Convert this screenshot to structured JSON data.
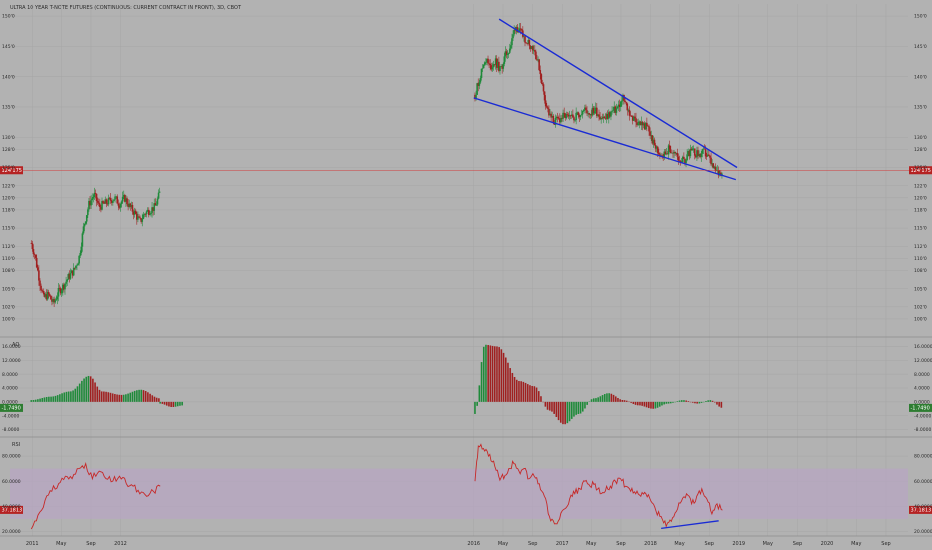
{
  "header": {
    "symbol_line": "ULTRA 10 YEAR T-NOTE FUTURES (CONTINUOUS: CURRENT CONTRACT IN FRONT), 3D, CBOT"
  },
  "colors": {
    "background": "#b2b2b2",
    "up": "#1f8a3a",
    "down": "#a02020",
    "trendline": "#1a2bd4",
    "rsi_line": "#c62828",
    "rsi_band": "#b7a6c2",
    "price_line": "#d13a3a",
    "badge_red": "#b52222",
    "badge_green": "#2e7d32"
  },
  "chart_data": [
    {
      "type": "candlestick",
      "pane": "price",
      "price_ticks": [
        "150'0",
        "145'0",
        "140'0",
        "135'0",
        "130'0",
        "128'0",
        "125'0",
        "122'0",
        "120'0",
        "118'0",
        "115'0",
        "112'0",
        "110'0",
        "108'0",
        "105'0",
        "102'0",
        "100'0"
      ],
      "current_price_label": "124'175",
      "current_price": 124.55,
      "series": [
        {
          "x": [
            "2010-12-28",
            "2011-01-12",
            "2011-02-02",
            "2011-02-16",
            "2011-03-09",
            "2011-03-30",
            "2011-04-20",
            "2011-05-11",
            "2011-06-01",
            "2011-06-22",
            "2011-07-13",
            "2011-08-03",
            "2011-08-24",
            "2011-09-14",
            "2011-10-05",
            "2011-10-26",
            "2011-11-16",
            "2011-12-07",
            "2011-12-28",
            "2012-01-18",
            "2012-02-08",
            "2012-02-29",
            "2012-03-21",
            "2012-04-11",
            "2012-05-02",
            "2012-05-23",
            "2012-06-13"
          ],
          "close": [
            112.5,
            110.5,
            106.0,
            103.5,
            104.0,
            102.5,
            104.5,
            105.5,
            107.0,
            108.0,
            110.0,
            115.5,
            119.0,
            120.5,
            118.5,
            119.0,
            119.5,
            120.0,
            119.0,
            120.0,
            118.5,
            117.5,
            116.0,
            117.5,
            118.0,
            118.5,
            121.0
          ]
        },
        {
          "x": [
            "2016-01-06",
            "2016-01-27",
            "2016-02-17",
            "2016-03-09",
            "2016-03-30",
            "2016-04-20",
            "2016-05-11",
            "2016-06-01",
            "2016-06-22",
            "2016-07-06",
            "2016-07-27",
            "2016-08-17",
            "2016-09-07",
            "2016-09-28",
            "2016-10-19",
            "2016-11-09",
            "2016-11-30",
            "2016-12-21",
            "2017-01-11",
            "2017-02-01",
            "2017-02-22",
            "2017-03-15",
            "2017-04-05",
            "2017-04-26",
            "2017-05-17",
            "2017-06-07",
            "2017-06-28",
            "2017-07-19",
            "2017-08-09",
            "2017-08-30",
            "2017-09-08",
            "2017-09-29",
            "2017-10-20",
            "2017-11-10",
            "2017-12-01",
            "2017-12-22",
            "2018-01-12",
            "2018-02-02",
            "2018-02-23",
            "2018-03-16",
            "2018-04-06",
            "2018-04-27",
            "2018-05-18",
            "2018-06-08",
            "2018-06-29",
            "2018-07-20",
            "2018-08-10",
            "2018-08-31",
            "2018-09-21",
            "2018-10-12",
            "2018-10-26"
          ],
          "close": [
            137.0,
            140.0,
            143.0,
            141.5,
            142.5,
            141.0,
            143.5,
            145.0,
            148.5,
            147.5,
            146.5,
            145.5,
            144.5,
            141.5,
            136.5,
            133.5,
            132.5,
            133.0,
            133.5,
            133.0,
            133.5,
            134.0,
            134.5,
            134.0,
            134.5,
            133.5,
            133.0,
            134.0,
            134.5,
            135.5,
            136.5,
            134.5,
            133.0,
            132.5,
            132.0,
            131.5,
            129.0,
            127.5,
            127.0,
            128.0,
            127.5,
            126.5,
            126.0,
            127.5,
            127.5,
            127.0,
            127.5,
            126.5,
            124.5,
            124.0,
            124.5
          ]
        }
      ],
      "trendlines": [
        {
          "name": "upper",
          "from": {
            "x": "2016-04-15",
            "y": 149.5
          },
          "to": {
            "x": "2018-12-25",
            "y": 125.0
          }
        },
        {
          "name": "lower",
          "from": {
            "x": "2016-01-01",
            "y": 136.5
          },
          "to": {
            "x": "2018-12-20",
            "y": 123.0
          }
        }
      ]
    },
    {
      "type": "bar",
      "pane": "AO",
      "label": "AO",
      "ticks": [
        "16.0000",
        "12.0000",
        "8.0000",
        "4.0000",
        "0.0000",
        "-4.0000",
        "-8.0000"
      ],
      "ylim": [
        -9.0,
        17.0
      ],
      "current_value_label": "-1.7490",
      "segments": [
        {
          "x_start": "2010-12-28",
          "x_end": "2012-06-13",
          "peaks": [
            [
              0.0,
              0.5
            ],
            [
              0.15,
              1.5
            ],
            [
              0.3,
              3.0
            ],
            [
              0.45,
              7.5
            ],
            [
              0.55,
              3.0
            ],
            [
              0.7,
              2.0
            ],
            [
              0.85,
              3.5
            ],
            [
              1.0,
              1.0
            ]
          ]
        },
        {
          "x_start": "2012-06-13",
          "x_end": "2012-09-20",
          "peaks": [
            [
              0.0,
              -0.5
            ],
            [
              0.5,
              -1.5
            ],
            [
              1.0,
              -1.0
            ]
          ]
        },
        {
          "x_start": "2016-01-06",
          "x_end": "2018-10-26",
          "peaks": [
            [
              0.0,
              -3.5
            ],
            [
              0.04,
              16.5
            ],
            [
              0.09,
              16.0
            ],
            [
              0.18,
              6.0
            ],
            [
              0.24,
              4.5
            ],
            [
              0.3,
              -2.5
            ],
            [
              0.36,
              -6.5
            ],
            [
              0.42,
              -3.5
            ],
            [
              0.48,
              1.0
            ],
            [
              0.54,
              2.5
            ],
            [
              0.6,
              0.5
            ],
            [
              0.66,
              -1.0
            ],
            [
              0.72,
              -2.0
            ],
            [
              0.78,
              -0.5
            ],
            [
              0.84,
              0.5
            ],
            [
              0.9,
              -0.5
            ],
            [
              0.95,
              0.5
            ],
            [
              1.0,
              -1.75
            ]
          ]
        }
      ]
    },
    {
      "type": "line",
      "pane": "RSI",
      "label": "RSI",
      "ticks": [
        "80.0000",
        "60.0000",
        "40.0000",
        "20.0000"
      ],
      "ylim": [
        18.0,
        92.0
      ],
      "band": [
        30,
        70
      ],
      "current_value_label": "37.1813",
      "segments": [
        {
          "x": [
            "2010-12-28",
            "2011-01-25",
            "2011-02-23",
            "2011-03-23",
            "2011-04-20",
            "2011-05-18",
            "2011-06-15",
            "2011-07-13",
            "2011-08-10",
            "2011-09-07",
            "2011-10-05",
            "2011-11-02",
            "2011-11-30",
            "2011-12-28",
            "2012-01-25",
            "2012-02-22",
            "2012-03-21",
            "2012-04-18",
            "2012-05-16",
            "2012-06-13"
          ],
          "y": [
            22,
            33,
            45,
            52,
            58,
            64,
            62,
            70,
            74,
            62,
            68,
            62,
            60,
            64,
            58,
            56,
            50,
            48,
            52,
            56
          ]
        },
        {
          "x": [
            "2016-01-06",
            "2016-01-20",
            "2016-02-10",
            "2016-03-02",
            "2016-03-23",
            "2016-04-13",
            "2016-05-04",
            "2016-05-25",
            "2016-06-15",
            "2016-07-06",
            "2016-07-27",
            "2016-08-17",
            "2016-09-07",
            "2016-09-28",
            "2016-10-19",
            "2016-11-09",
            "2016-11-30",
            "2016-12-21",
            "2017-01-11",
            "2017-02-01",
            "2017-02-22",
            "2017-03-15",
            "2017-04-05",
            "2017-04-26",
            "2017-05-17",
            "2017-06-07",
            "2017-06-28",
            "2017-07-19",
            "2017-08-09",
            "2017-08-30",
            "2017-09-20",
            "2017-10-11",
            "2017-11-01",
            "2017-11-22",
            "2017-12-13",
            "2018-01-03",
            "2018-01-24",
            "2018-02-14",
            "2018-03-07",
            "2018-03-28",
            "2018-04-18",
            "2018-05-09",
            "2018-05-30",
            "2018-06-20",
            "2018-07-11",
            "2018-08-01",
            "2018-08-22",
            "2018-09-12",
            "2018-10-03",
            "2018-10-26"
          ],
          "y": [
            60,
            88,
            86,
            80,
            76,
            64,
            62,
            70,
            74,
            68,
            70,
            62,
            64,
            58,
            48,
            32,
            26,
            30,
            38,
            46,
            50,
            54,
            60,
            56,
            58,
            50,
            52,
            56,
            60,
            62,
            56,
            52,
            50,
            48,
            50,
            44,
            36,
            32,
            24,
            28,
            36,
            44,
            50,
            42,
            48,
            54,
            46,
            34,
            42,
            37
          ]
        }
      ],
      "divergence_line": {
        "from": {
          "x": "2018-02-14",
          "y": 22.5
        },
        "to": {
          "x": "2018-10-10",
          "y": 28.5
        }
      }
    }
  ],
  "x_axis": {
    "labels": [
      {
        "text": "2011",
        "date": "2011-01-01"
      },
      {
        "text": "May",
        "date": "2011-05-01"
      },
      {
        "text": "Sep",
        "date": "2011-09-01"
      },
      {
        "text": "2012",
        "date": "2012-01-01"
      },
      {
        "text": "2016",
        "date": "2016-01-01"
      },
      {
        "text": "May",
        "date": "2016-05-01"
      },
      {
        "text": "Sep",
        "date": "2016-09-01"
      },
      {
        "text": "2017",
        "date": "2017-01-01"
      },
      {
        "text": "May",
        "date": "2017-05-01"
      },
      {
        "text": "Sep",
        "date": "2017-09-01"
      },
      {
        "text": "2018",
        "date": "2018-01-01"
      },
      {
        "text": "May",
        "date": "2018-05-01"
      },
      {
        "text": "Sep",
        "date": "2018-09-01"
      },
      {
        "text": "2019",
        "date": "2019-01-01"
      },
      {
        "text": "May",
        "date": "2019-05-01"
      },
      {
        "text": "Sep",
        "date": "2019-09-01"
      },
      {
        "text": "2020",
        "date": "2020-01-01"
      },
      {
        "text": "May",
        "date": "2020-05-01"
      },
      {
        "text": "Sep",
        "date": "2020-09-01"
      }
    ]
  }
}
